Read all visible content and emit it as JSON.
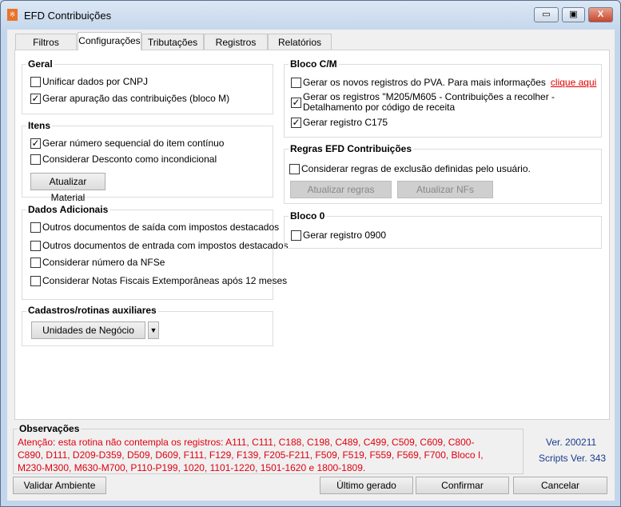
{
  "window": {
    "title": "EFD Contribuições",
    "minimize": "▭",
    "maximize": "▣",
    "close": "X"
  },
  "tabs": [
    "Filtros",
    "Configurações",
    "Tributações",
    "Registros",
    "Relatórios"
  ],
  "geral": {
    "title": "Geral",
    "items": [
      {
        "label": "Unificar dados por CNPJ",
        "checked": false
      },
      {
        "label": "Gerar apuração das contribuições (bloco M)",
        "checked": true
      }
    ]
  },
  "itens": {
    "title": "Itens",
    "items": [
      {
        "label": "Gerar número sequencial do item contínuo",
        "checked": true
      },
      {
        "label": "Considerar Desconto como incondicional",
        "checked": false
      }
    ],
    "button": "Atualizar Material"
  },
  "dados": {
    "title": "Dados Adicionais",
    "items": [
      {
        "label": "Outros documentos de saída com impostos destacados",
        "checked": false
      },
      {
        "label": "Outros documentos de entrada com impostos destacados",
        "checked": false
      },
      {
        "label": "Considerar número da NFSe",
        "checked": false
      },
      {
        "label": "Considerar Notas Fiscais Extemporâneas após 12 meses",
        "checked": false
      }
    ]
  },
  "cadastros": {
    "title": "Cadastros/rotinas auxiliares",
    "button": "Unidades de Negócio",
    "arrow": "▼"
  },
  "blococm": {
    "title": "Bloco C/M",
    "item1": "Gerar os novos registros do PVA. Para mais informações",
    "link": "clique aqui",
    "item2": "Gerar os registros \"M205/M605 - Contribuições a recolher - Detalhamento por código de receita",
    "item3": "Gerar registro C175",
    "checks": [
      false,
      true,
      true
    ]
  },
  "regras": {
    "title": "Regras EFD Contribuições",
    "item": "Considerar regras de exclusão definidas pelo usuário.",
    "btn1": "Atualizar regras",
    "btn2": "Atualizar NFs"
  },
  "bloco0": {
    "title": "Bloco 0",
    "item": "Gerar registro 0900"
  },
  "obs": {
    "title": "Observações",
    "text": "Atenção: esta rotina não contempla os registros: A111, C111, C188, C198, C489, C499, C509, C609, C800-C890, D111, D209-D359, D509, D609, F111, F129, F139, F205-F211, F509, F519, F559, F569, F700, Bloco I, M230-M300, M630-M700, P110-P199, 1020, 1101-1220, 1501-1620 e 1800-1809."
  },
  "version": {
    "ver": "Ver. 200211",
    "scripts": "Scripts Ver. 343"
  },
  "buttons": {
    "validar": "Validar Ambiente",
    "ultimo": "Último gerado",
    "confirmar": "Confirmar",
    "cancelar": "Cancelar"
  },
  "check_mark": "✓"
}
